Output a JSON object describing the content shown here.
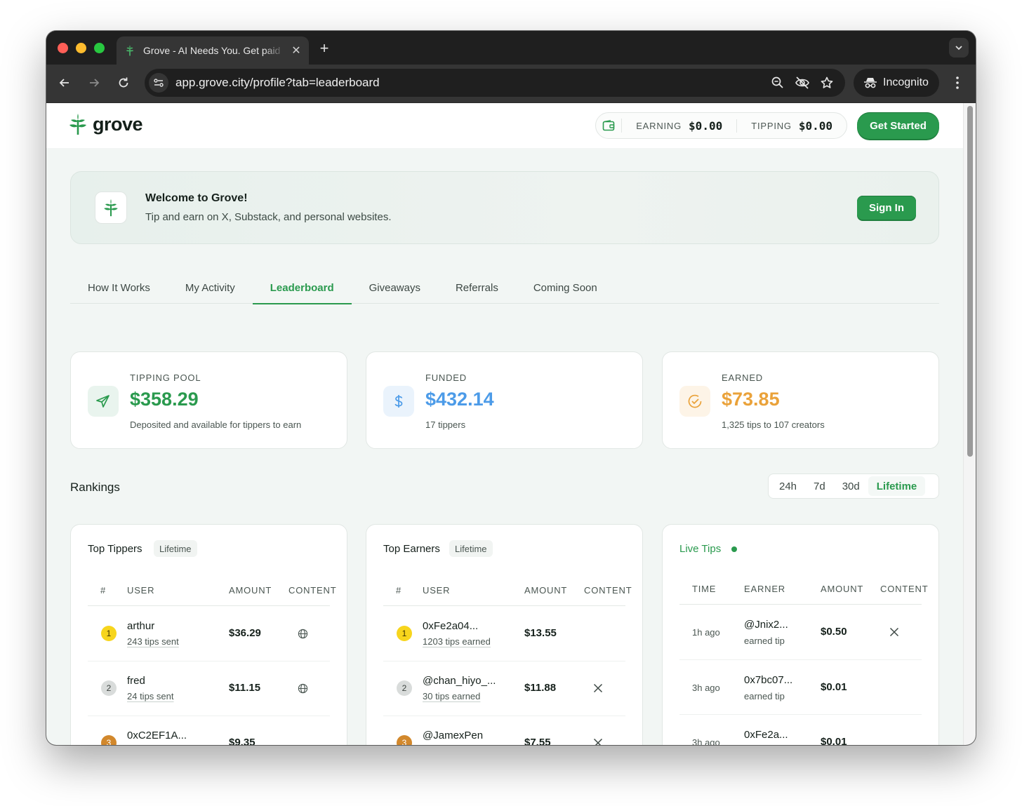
{
  "browser": {
    "tab_title": "Grove - AI Needs You. Get paid",
    "new_tab": "+",
    "tab_close": "✕",
    "url": "app.grove.city/profile?tab=leaderboard",
    "incognito_label": "Incognito"
  },
  "header": {
    "logo_text": "grove",
    "earning_label": "EARNING",
    "earning_value": "$0.00",
    "tipping_label": "TIPPING",
    "tipping_value": "$0.00",
    "get_started": "Get Started"
  },
  "welcome": {
    "title": "Welcome to Grove!",
    "subtitle": "Tip and earn on X, Substack, and personal websites.",
    "sign_in": "Sign In"
  },
  "tabs": [
    {
      "label": "How It Works"
    },
    {
      "label": "My Activity"
    },
    {
      "label": "Leaderboard",
      "active": true
    },
    {
      "label": "Giveaways"
    },
    {
      "label": "Referrals"
    },
    {
      "label": "Coming Soon"
    }
  ],
  "stats": {
    "pool": {
      "label": "TIPPING POOL",
      "value": "$358.29",
      "sub": "Deposited and available for tippers to earn",
      "color": "#2a9a4e"
    },
    "funded": {
      "label": "FUNDED",
      "value": "$432.14",
      "sub": "17 tippers",
      "color": "#4c9be8"
    },
    "earned": {
      "label": "EARNED",
      "value": "$73.85",
      "sub": "1,325 tips to 107 creators",
      "color": "#eaa23a"
    }
  },
  "rankings": {
    "title": "Rankings",
    "periods": [
      {
        "label": "24h"
      },
      {
        "label": "7d"
      },
      {
        "label": "30d"
      },
      {
        "label": "Lifetime",
        "active": true
      }
    ]
  },
  "top_tippers": {
    "title": "Top Tippers",
    "badge": "Lifetime",
    "headers": [
      "#",
      "USER",
      "AMOUNT",
      "CONTENT"
    ],
    "rows": [
      {
        "rank": "1",
        "user": "arthur",
        "sub": "243 tips sent",
        "amount": "$36.29",
        "content": "globe-icon"
      },
      {
        "rank": "2",
        "user": "fred",
        "sub": "24 tips sent",
        "amount": "$11.15",
        "content": "globe-icon"
      },
      {
        "rank": "3",
        "user": "0xC2EF1A...",
        "sub": "",
        "amount": "$9.35",
        "content": ""
      }
    ]
  },
  "top_earners": {
    "title": "Top Earners",
    "badge": "Lifetime",
    "headers": [
      "#",
      "USER",
      "AMOUNT",
      "CONTENT"
    ],
    "rows": [
      {
        "rank": "1",
        "user": "0xFe2a04...",
        "sub": "1203 tips earned",
        "amount": "$13.55",
        "content": ""
      },
      {
        "rank": "2",
        "user": "@chan_hiyo_...",
        "sub": "30 tips earned",
        "amount": "$11.88",
        "content": "x-icon"
      },
      {
        "rank": "3",
        "user": "@JamexPen",
        "sub": "",
        "amount": "$7.55",
        "content": "x-icon"
      }
    ]
  },
  "live_tips": {
    "title": "Live Tips",
    "headers": [
      "TIME",
      "EARNER",
      "AMOUNT",
      "CONTENT"
    ],
    "rows": [
      {
        "time": "1h ago",
        "earner": "@Jnix2...",
        "sub": "earned tip",
        "amount": "$0.50",
        "content": "x-icon"
      },
      {
        "time": "3h ago",
        "earner": "0x7bc07...",
        "sub": "earned tip",
        "amount": "$0.01",
        "content": ""
      },
      {
        "time": "3h ago",
        "earner": "0xFe2a...",
        "sub": "",
        "amount": "$0.01",
        "content": ""
      }
    ]
  },
  "colors": {
    "accent": "#2a9a4e",
    "funded": "#4c9be8",
    "earned": "#eaa23a"
  }
}
